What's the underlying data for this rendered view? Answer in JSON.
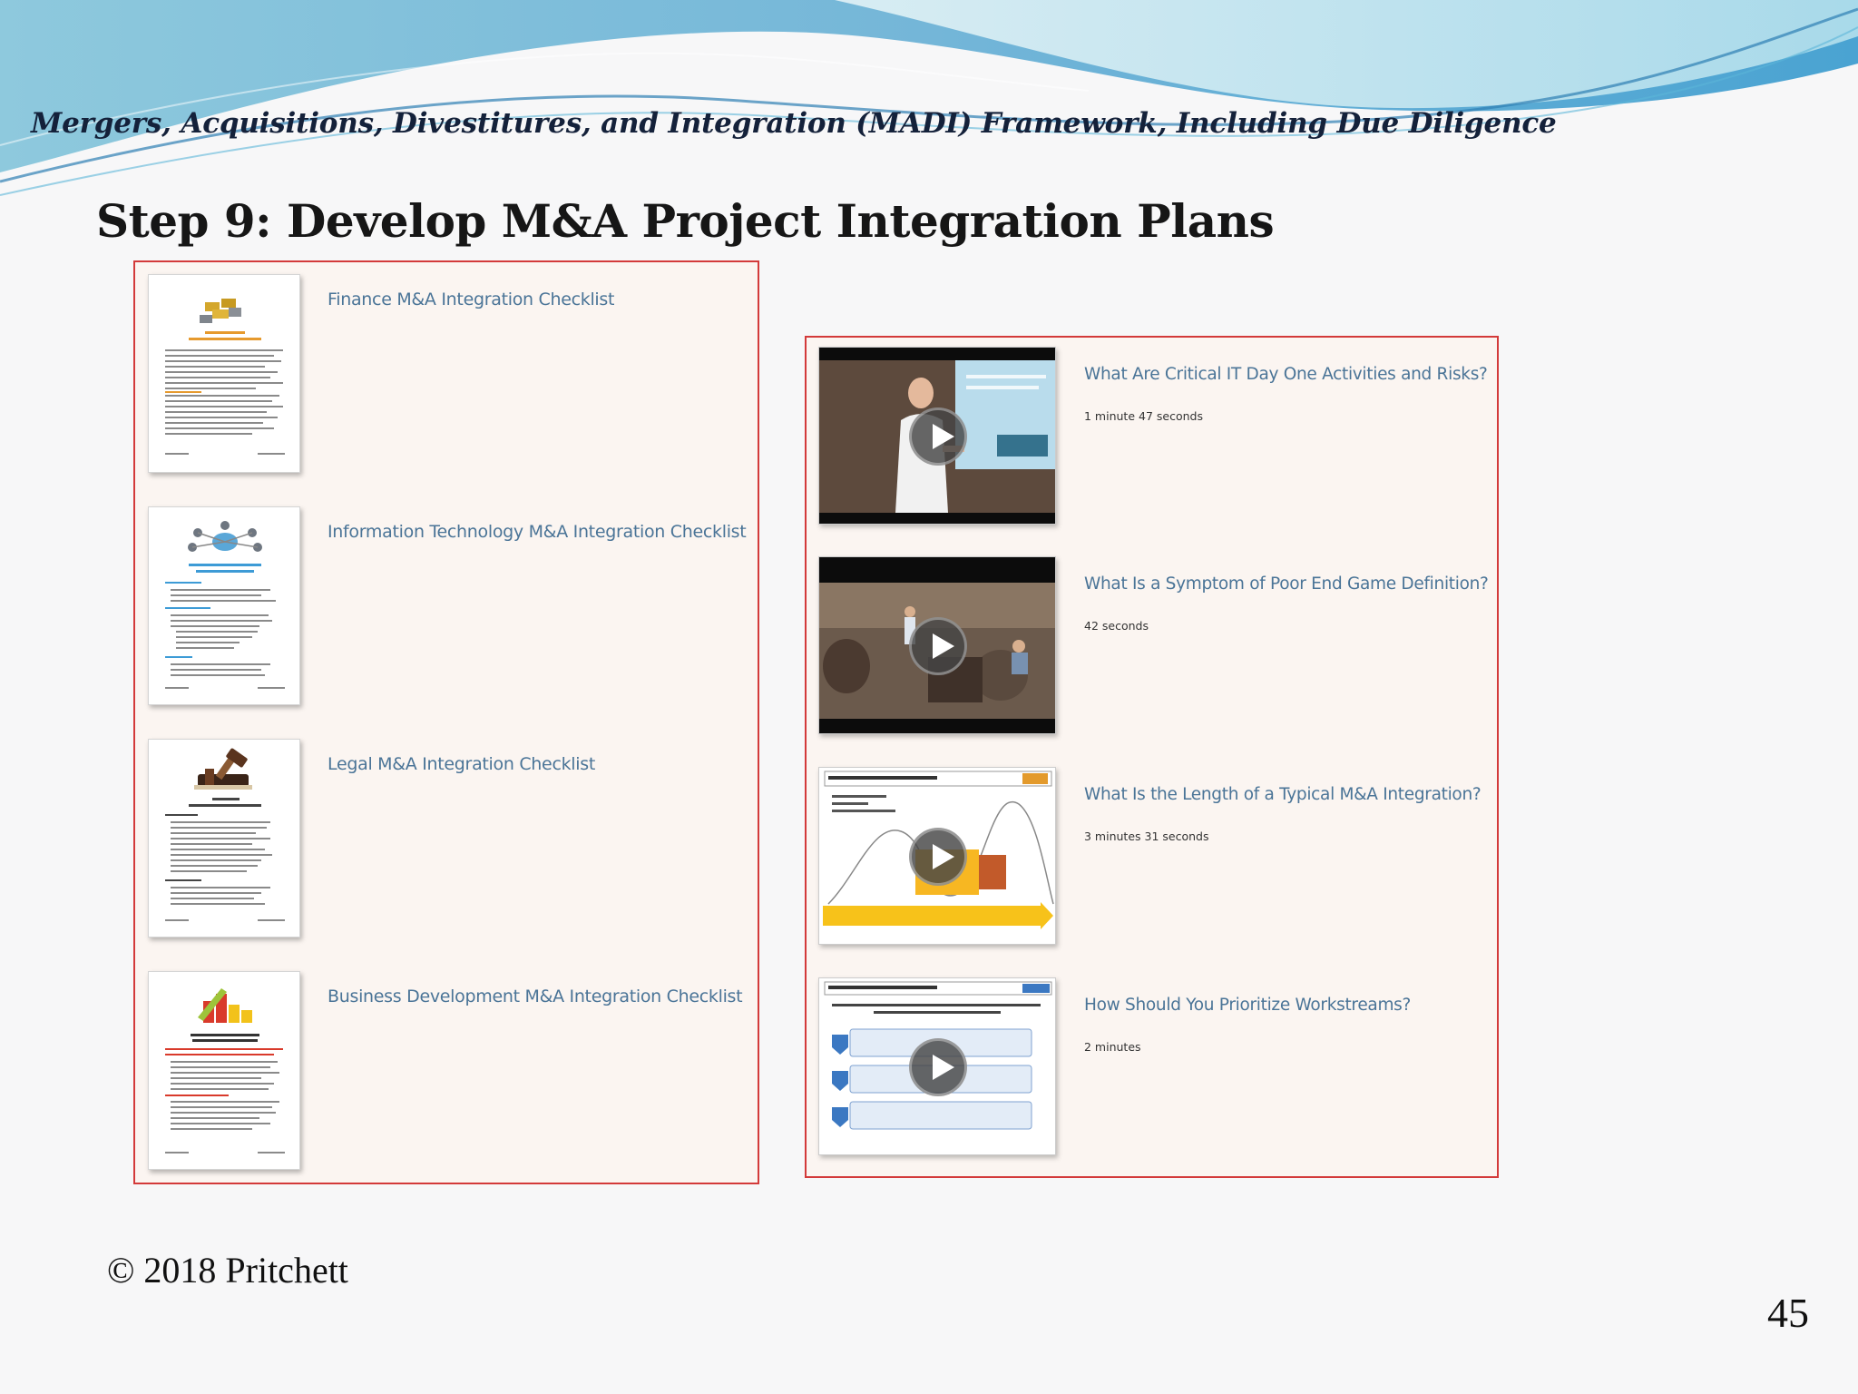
{
  "header": {
    "title": "Mergers, Acquisitions, Divestitures, and Integration (MADI) Framework, Including Due Diligence"
  },
  "slide": {
    "title": "Step 9: Develop M&A Project Integration Plans"
  },
  "checklists": [
    {
      "label": "Finance M&A Integration Checklist",
      "thumb_icon": "gold-bars-icon"
    },
    {
      "label": "Information Technology M&A Integration Checklist",
      "thumb_icon": "network-icon"
    },
    {
      "label": "Legal M&A Integration Checklist",
      "thumb_icon": "gavel-icon"
    },
    {
      "label": "Business Development M&A Integration Checklist",
      "thumb_icon": "bar-chart-icon"
    }
  ],
  "videos": [
    {
      "title": "What Are Critical IT Day One Activities and Risks?",
      "duration": "1 minute 47 seconds"
    },
    {
      "title": "What Is a Symptom of Poor End Game Definition?",
      "duration": "42 seconds"
    },
    {
      "title": "What Is the Length of a Typical M&A Integration?",
      "duration": "3 minutes 31 seconds"
    },
    {
      "title": "How Should You Prioritize Workstreams?",
      "duration": "2 minutes"
    }
  ],
  "footer": {
    "copyright": "© 2018 Pritchett",
    "page_number": "45"
  },
  "colors": {
    "link": "#4a7497",
    "panel_border": "#d33a3a",
    "panel_background": "#fbf5f1",
    "wave_blue": "#5aaed6"
  }
}
